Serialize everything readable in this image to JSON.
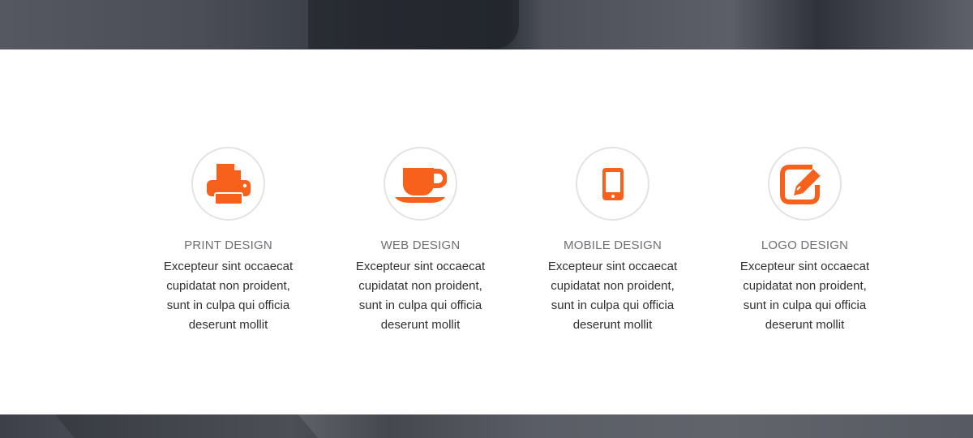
{
  "colors": {
    "accent": "#f7611c",
    "title": "#6d6f73",
    "text": "#2f3033",
    "circle_border": "#e3e3e3",
    "hero": "#4c4f56"
  },
  "services": [
    {
      "icon": "printer-icon",
      "title": "PRINT DESIGN",
      "description": "Excepteur sint occaecat cupidatat non proident, sunt in culpa qui officia deserunt mollit"
    },
    {
      "icon": "coffee-cup-icon",
      "title": "WEB DESIGN",
      "description": "Excepteur sint occaecat cupidatat non proident, sunt in culpa qui officia deserunt mollit"
    },
    {
      "icon": "mobile-phone-icon",
      "title": "MOBILE DESIGN",
      "description": "Excepteur sint occaecat cupidatat non proident, sunt in culpa qui officia deserunt mollit"
    },
    {
      "icon": "edit-pencil-icon",
      "title": "LOGO DESIGN",
      "description": "Excepteur sint occaecat cupidatat non proident, sunt in culpa qui officia deserunt mollit"
    }
  ]
}
